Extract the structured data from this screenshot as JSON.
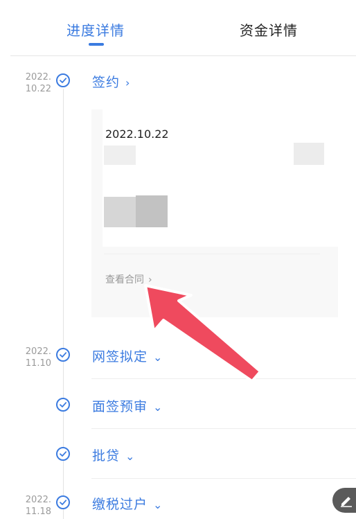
{
  "tabs": [
    {
      "label": "进度详情",
      "active": true
    },
    {
      "label": "资金详情",
      "active": false
    }
  ],
  "colors": {
    "accent": "#3b7be0",
    "arrow": "#ef4a5e"
  },
  "steps": [
    {
      "date_year": "2022.",
      "date_md": "10.22",
      "label": "签约",
      "chevron": "right-chevron-icon"
    },
    {
      "date_year": "2022.",
      "date_md": "11.10",
      "label": "网签拟定",
      "chevron": "down-chevron-icon"
    },
    {
      "date_year": "",
      "date_md": "",
      "label": "面签预审",
      "chevron": "down-chevron-icon"
    },
    {
      "date_year": "",
      "date_md": "",
      "label": "批贷",
      "chevron": "down-chevron-icon"
    },
    {
      "date_year": "2022.",
      "date_md": "11.18",
      "label": "缴税过户",
      "chevron": "down-chevron-icon"
    }
  ],
  "signing_card": {
    "date": "2022.10.22",
    "view_contract": "查看合同"
  }
}
